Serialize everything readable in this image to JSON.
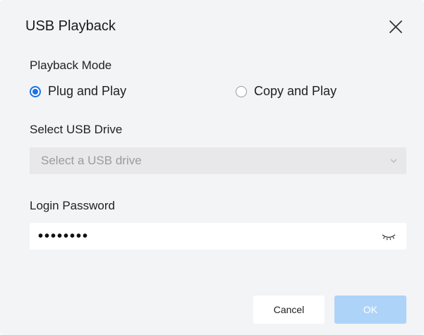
{
  "dialog": {
    "title": "USB Playback"
  },
  "playback_mode": {
    "label": "Playback Mode",
    "options": [
      {
        "label": "Plug and Play",
        "checked": true
      },
      {
        "label": "Copy and Play",
        "checked": false
      }
    ]
  },
  "usb_drive": {
    "label": "Select USB Drive",
    "placeholder": "Select a USB drive",
    "disabled": true
  },
  "password": {
    "label": "Login Password",
    "value": "••••••••"
  },
  "buttons": {
    "cancel": "Cancel",
    "ok": "OK"
  },
  "colors": {
    "accent": "#1a73e8",
    "ok_disabled": "#aed3f8",
    "background": "#f3f4f6"
  }
}
